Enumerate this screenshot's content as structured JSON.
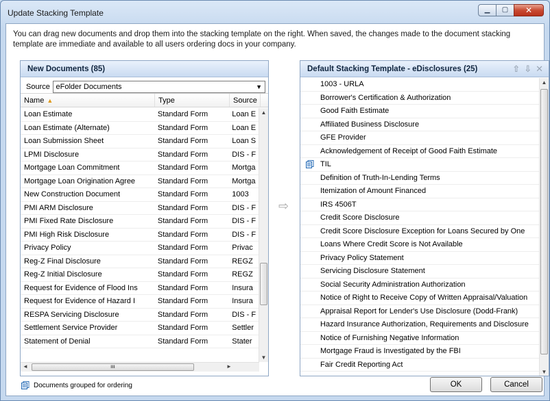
{
  "window": {
    "title": "Update Stacking Template",
    "minimize": "▁",
    "maximize": "▢",
    "close": "✕"
  },
  "intro": "You can drag new documents and drop them into the stacking template on the right. When saved, the changes made to the document stacking template are immediate and available to all users ordering docs in your company.",
  "left_panel": {
    "title": "New Documents (85)",
    "source_label": "Source",
    "source_value": "eFolder Documents",
    "columns": [
      "Name",
      "Type",
      "Source"
    ],
    "rows": [
      [
        "Loan Estimate",
        "Standard Form",
        "Loan E"
      ],
      [
        "Loan Estimate (Alternate)",
        "Standard Form",
        "Loan E"
      ],
      [
        "Loan Submission Sheet",
        "Standard Form",
        "Loan S"
      ],
      [
        "LPMI Disclosure",
        "Standard Form",
        "DIS - F"
      ],
      [
        "Mortgage Loan Commitment",
        "Standard Form",
        "Mortga"
      ],
      [
        "Mortgage Loan Origination Agree",
        "Standard Form",
        "Mortga"
      ],
      [
        "New Construction Document",
        "Standard Form",
        "1003"
      ],
      [
        "PMI ARM Disclosure",
        "Standard Form",
        "DIS - F"
      ],
      [
        "PMI Fixed Rate Disclosure",
        "Standard Form",
        "DIS - F"
      ],
      [
        "PMI High Risk Disclosure",
        "Standard Form",
        "DIS - F"
      ],
      [
        "Privacy Policy",
        "Standard Form",
        "Privac"
      ],
      [
        "Reg-Z Final Disclosure",
        "Standard Form",
        "REGZ"
      ],
      [
        "Reg-Z Initial Disclosure",
        "Standard Form",
        "REGZ"
      ],
      [
        "Request for Evidence of Flood Ins",
        "Standard Form",
        "Insura"
      ],
      [
        "Request for Evidence of Hazard I",
        "Standard Form",
        "Insura"
      ],
      [
        "RESPA Servicing Disclosure",
        "Standard Form",
        "DIS - F"
      ],
      [
        "Settlement Service Provider",
        "Standard Form",
        "Settler"
      ],
      [
        "Statement of Denial",
        "Standard Form",
        "Stater"
      ]
    ]
  },
  "right_panel": {
    "title": "Default Stacking Template - eDisclosures (25)",
    "items": [
      {
        "label": "1003 - URLA",
        "grouped": false
      },
      {
        "label": "Borrower's Certification & Authorization",
        "grouped": false
      },
      {
        "label": "Good Faith Estimate",
        "grouped": false
      },
      {
        "label": "Affiliated Business Disclosure",
        "grouped": false
      },
      {
        "label": "GFE Provider",
        "grouped": false
      },
      {
        "label": "Acknowledgement of Receipt of Good Faith Estimate",
        "grouped": false
      },
      {
        "label": "TIL",
        "grouped": true
      },
      {
        "label": "Definition of Truth-In-Lending Terms",
        "grouped": false
      },
      {
        "label": "Itemization of Amount Financed",
        "grouped": false
      },
      {
        "label": "IRS 4506T",
        "grouped": false
      },
      {
        "label": "Credit Score Disclosure",
        "grouped": false
      },
      {
        "label": "Credit Score Disclosure Exception for Loans Secured by One",
        "grouped": false
      },
      {
        "label": "Loans Where Credit Score is Not Available",
        "grouped": false
      },
      {
        "label": "Privacy Policy Statement",
        "grouped": false
      },
      {
        "label": "Servicing Disclosure Statement",
        "grouped": false
      },
      {
        "label": "Social Security Administration Authorization",
        "grouped": false
      },
      {
        "label": "Notice of Right to Receive Copy of Written Appraisal/Valuation",
        "grouped": false
      },
      {
        "label": "Appraisal Report for Lender's Use Disclosure (Dodd-Frank)",
        "grouped": false
      },
      {
        "label": "Hazard Insurance Authorization, Requirements and Disclosure",
        "grouped": false
      },
      {
        "label": "Notice of Furnishing Negative Information",
        "grouped": false
      },
      {
        "label": "Mortgage Fraud is Investigated by the FBI",
        "grouped": false
      },
      {
        "label": "Fair Credit Reporting Act",
        "grouped": false
      }
    ]
  },
  "footer": {
    "note": "Documents grouped for ordering",
    "ok_label": "OK",
    "cancel_label": "Cancel"
  },
  "colors": {
    "accent": "#c9dbf1",
    "sort_arrow": "#e09a1e",
    "close_button": "#c94b33"
  },
  "icons": [
    "grouped-documents-icon",
    "sort-ascending-icon",
    "move-right-arrow-icon",
    "move-up-icon",
    "move-down-icon",
    "remove-icon"
  ]
}
